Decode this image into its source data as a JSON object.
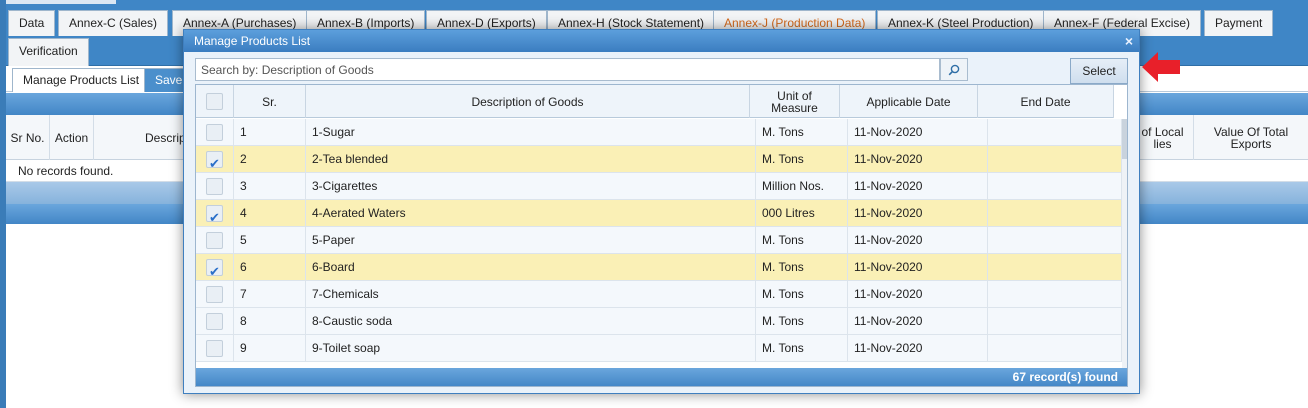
{
  "tabs": [
    {
      "label": "Data"
    },
    {
      "label": "Annex-C (Sales)"
    },
    {
      "label": "Annex-A (Purchases)"
    },
    {
      "label": "Annex-B (Imports)"
    },
    {
      "label": "Annex-D (Exports)"
    },
    {
      "label": "Annex-H (Stock Statement)"
    },
    {
      "label": "Annex-J (Production Data)"
    },
    {
      "label": "Annex-K (Steel Production)"
    },
    {
      "label": "Annex-F (Federal Excise)"
    },
    {
      "label": "Payment"
    },
    {
      "label": "Verification"
    }
  ],
  "active_tab": "Annex-J (Production Data)",
  "subtabs": [
    {
      "label": "Manage Products List"
    },
    {
      "label": "Save"
    }
  ],
  "under_grid": {
    "headers": [
      "Sr No.",
      "Action",
      "Descript",
      "of Local lies",
      "Value Of Total Exports"
    ],
    "empty_text": "No records found."
  },
  "modal": {
    "title": "Manage Products List",
    "close_label": "×",
    "search_placeholder": "Search by: Description of Goods",
    "search_icon": "search-icon",
    "select_label": "Select",
    "columns": [
      "Sr.",
      "Description of Goods",
      "Unit of Measure",
      "Applicable Date",
      "End Date"
    ],
    "rows": [
      {
        "checked": false,
        "sr": "1",
        "desc": "1-Sugar",
        "uom": "M. Tons",
        "date": "11-Nov-2020",
        "end": ""
      },
      {
        "checked": true,
        "sr": "2",
        "desc": "2-Tea blended",
        "uom": "M. Tons",
        "date": "11-Nov-2020",
        "end": ""
      },
      {
        "checked": false,
        "sr": "3",
        "desc": "3-Cigarettes",
        "uom": "Million Nos.",
        "date": "11-Nov-2020",
        "end": ""
      },
      {
        "checked": true,
        "sr": "4",
        "desc": "4-Aerated Waters",
        "uom": "000 Litres",
        "date": "11-Nov-2020",
        "end": ""
      },
      {
        "checked": false,
        "sr": "5",
        "desc": "5-Paper",
        "uom": "M. Tons",
        "date": "11-Nov-2020",
        "end": ""
      },
      {
        "checked": true,
        "sr": "6",
        "desc": "6-Board",
        "uom": "M. Tons",
        "date": "11-Nov-2020",
        "end": ""
      },
      {
        "checked": false,
        "sr": "7",
        "desc": "7-Chemicals",
        "uom": "M. Tons",
        "date": "11-Nov-2020",
        "end": ""
      },
      {
        "checked": false,
        "sr": "8",
        "desc": "8-Caustic soda",
        "uom": "M. Tons",
        "date": "11-Nov-2020",
        "end": ""
      },
      {
        "checked": false,
        "sr": "9",
        "desc": "9-Toilet soap",
        "uom": "M. Tons",
        "date": "11-Nov-2020",
        "end": ""
      }
    ],
    "footer": "67 record(s) found"
  },
  "colors": {
    "header_blue": "#3f86c6",
    "selected_row": "#faf0b6",
    "active_tab_text": "#d46a1d",
    "arrow": "#e8202a"
  }
}
